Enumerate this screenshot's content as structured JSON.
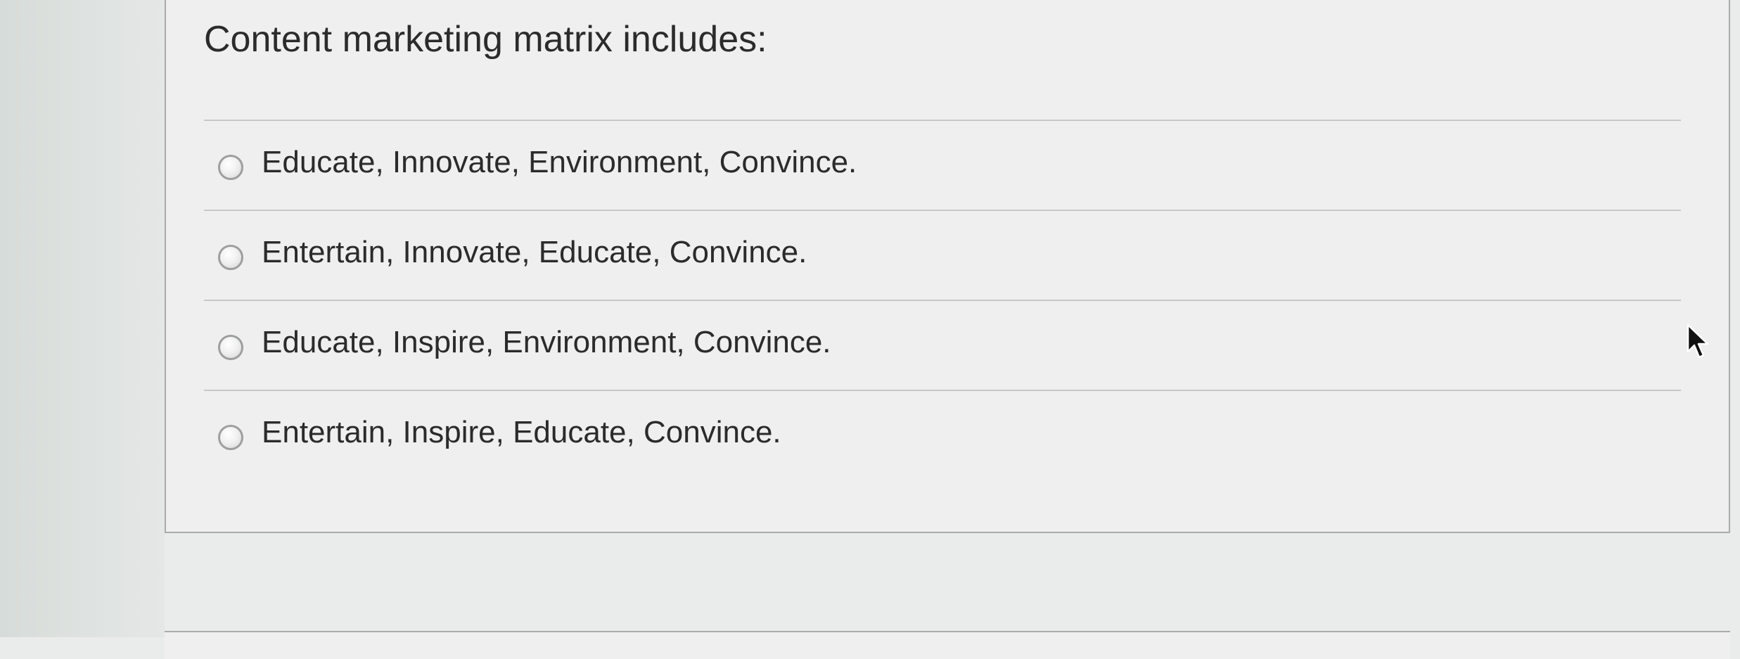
{
  "question": {
    "title": "Content marketing matrix includes:",
    "options": [
      {
        "label": "Educate, Innovate, Environment, Convince."
      },
      {
        "label": "Entertain, Innovate, Educate, Convince."
      },
      {
        "label": "Educate, Inspire, Environment, Convince."
      },
      {
        "label": "Entertain, Inspire, Educate, Convince."
      }
    ]
  },
  "icons": {
    "radio": "radio-unselected-icon",
    "cursor": "mouse-pointer-icon"
  },
  "colors": {
    "text": "#2b2b2b",
    "card_background": "#efefef",
    "card_border": "#a9aaa9",
    "divider": "#c6c8c7"
  }
}
